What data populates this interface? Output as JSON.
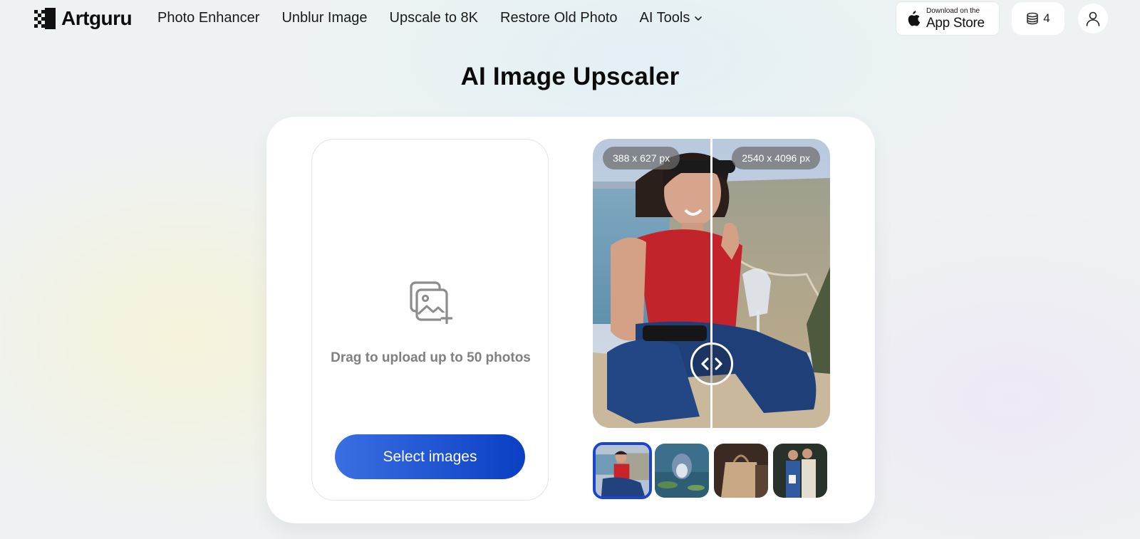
{
  "header": {
    "brand": "Artguru",
    "nav": [
      {
        "label": "Photo Enhancer"
      },
      {
        "label": "Unblur Image"
      },
      {
        "label": "Upscale to 8K"
      },
      {
        "label": "Restore Old Photo"
      },
      {
        "label": "AI Tools"
      }
    ],
    "app_store": {
      "small": "Download on the",
      "big": "App Store"
    },
    "credits": "4"
  },
  "page": {
    "title": "AI Image Upscaler"
  },
  "upload": {
    "hint": "Drag to upload up to 50 photos",
    "button": "Select images"
  },
  "preview": {
    "before_size": "388 x 627 px",
    "after_size": "2540 x 4096 px"
  },
  "samples": [
    {
      "name": "woman-on-rock",
      "selected": true
    },
    {
      "name": "anime-creature-pond",
      "selected": false
    },
    {
      "name": "paper-shopping-bag",
      "selected": false
    },
    {
      "name": "couple-portrait",
      "selected": false
    }
  ],
  "colors": {
    "accent": "#1a45d0",
    "button_gradient_start": "#3a6fe2",
    "button_gradient_end": "#0b3fc4"
  }
}
